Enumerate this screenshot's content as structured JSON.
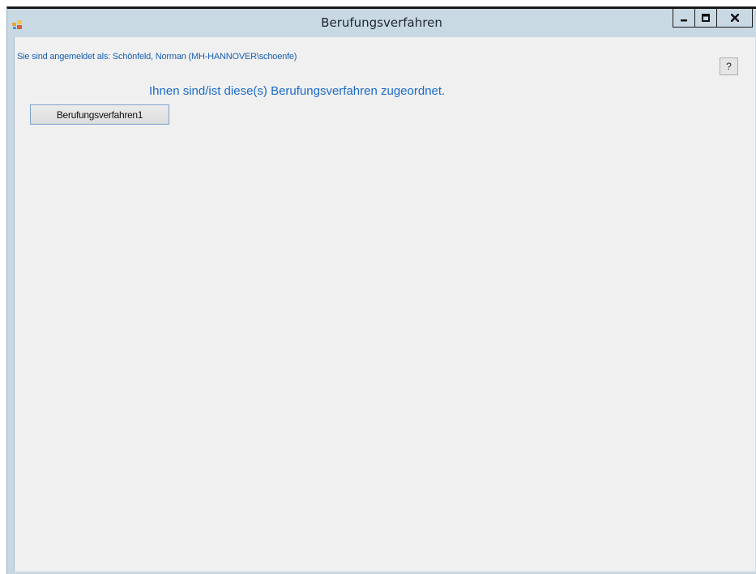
{
  "window": {
    "title": "Berufungsverfahren"
  },
  "controls": {
    "minimize_icon": "minimize-icon",
    "maximize_icon": "maximize-icon",
    "close_icon": "close-icon"
  },
  "content": {
    "login_label": "Sie sind angemeldet als: Schönfeld, Norman (MH-HANNOVER\\schoenfe)",
    "help_label": "?",
    "heading": "Ihnen sind/ist diese(s) Berufungsverfahren zugeordnet.",
    "procedures": [
      {
        "label": "Berufungsverfahren1"
      }
    ]
  },
  "colors": {
    "titlebar": "#c9d9e4",
    "client": "#f0f0f0",
    "accent_text": "#1a6bc9"
  }
}
